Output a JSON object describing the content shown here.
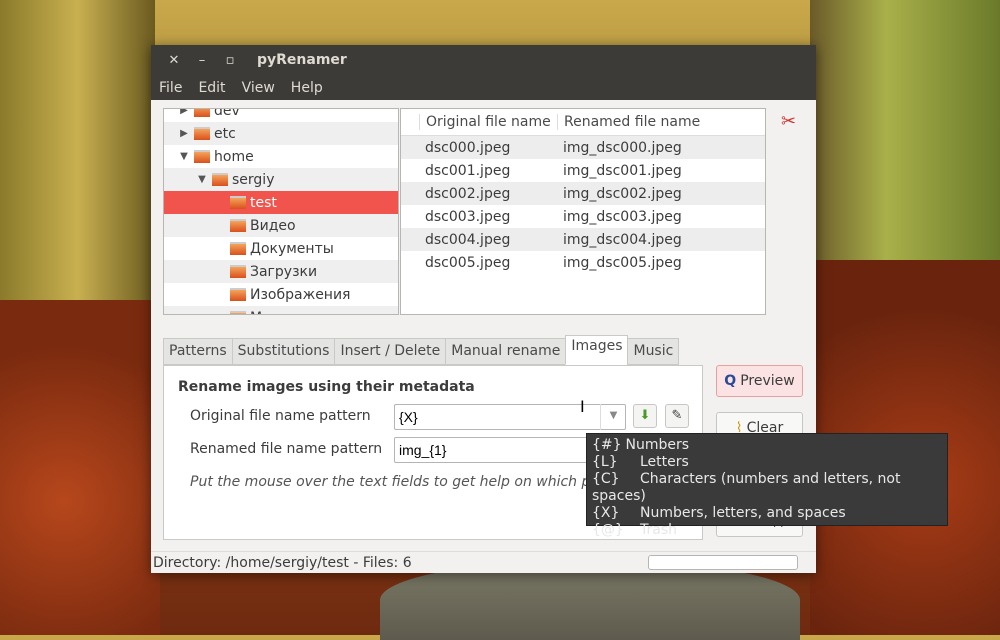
{
  "window": {
    "title": "pyRenamer",
    "close": "✕",
    "minimize": "–",
    "maximize": "▫"
  },
  "menu": [
    "File",
    "Edit",
    "View",
    "Help"
  ],
  "tree": [
    {
      "label": "dev",
      "expander": "▶",
      "level": 0
    },
    {
      "label": "etc",
      "expander": "▶",
      "level": 0
    },
    {
      "label": "home",
      "expander": "▼",
      "level": 0
    },
    {
      "label": "sergiy",
      "expander": "▼",
      "level": 1
    },
    {
      "label": "test",
      "expander": "",
      "level": 2,
      "selected": true
    },
    {
      "label": "Видео",
      "expander": "",
      "level": 2
    },
    {
      "label": "Документы",
      "expander": "",
      "level": 2
    },
    {
      "label": "Загрузки",
      "expander": "",
      "level": 2
    },
    {
      "label": "Изображения",
      "expander": "",
      "level": 2
    },
    {
      "label": "М...",
      "expander": "",
      "level": 2
    }
  ],
  "files": {
    "headers": [
      "Original file name",
      "Renamed file name"
    ],
    "rows": [
      [
        "dsc000.jpeg",
        "img_dsc000.jpeg"
      ],
      [
        "dsc001.jpeg",
        "img_dsc001.jpeg"
      ],
      [
        "dsc002.jpeg",
        "img_dsc002.jpeg"
      ],
      [
        "dsc003.jpeg",
        "img_dsc003.jpeg"
      ],
      [
        "dsc004.jpeg",
        "img_dsc004.jpeg"
      ],
      [
        "dsc005.jpeg",
        "img_dsc005.jpeg"
      ]
    ]
  },
  "tabs": [
    "Patterns",
    "Substitutions",
    "Insert / Delete",
    "Manual rename",
    "Images",
    "Music"
  ],
  "images_tab": {
    "heading": "Rename images using their metadata",
    "orig_label": "Original file name pattern",
    "orig_value": "{X}",
    "renamed_label": "Renamed file name pattern",
    "renamed_value": "img_{1}",
    "hint": "Put the mouse over the text fields to get help on which patterns to use"
  },
  "buttons": {
    "preview": "Preview",
    "clear": "Clear",
    "exit": "Выход"
  },
  "status": "Directory: /home/sergiy/test - Files: 6",
  "progress": 0,
  "tooltip": [
    [
      "{#}",
      "Numbers"
    ],
    [
      "{L}",
      "Letters"
    ],
    [
      "{C}",
      "Characters (numbers and letters, not spaces)"
    ],
    [
      "{X}",
      "Numbers, letters, and spaces"
    ],
    [
      "{@}",
      "Trash"
    ]
  ]
}
